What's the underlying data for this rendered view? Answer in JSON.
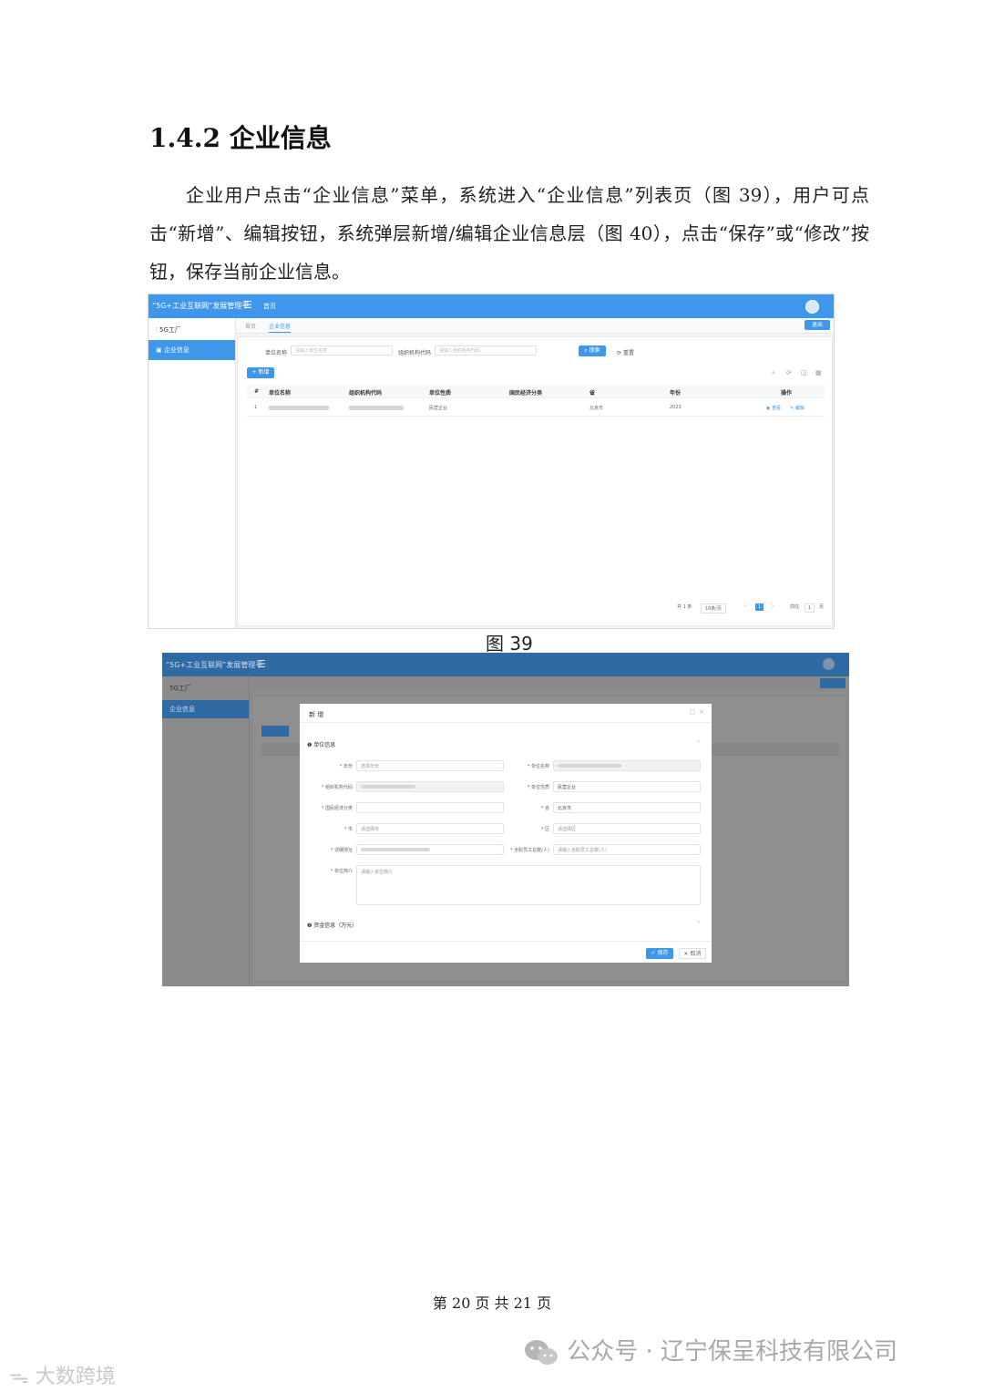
{
  "heading": "1.4.2 企业信息",
  "paragraph": "企业用户点击“企业信息”菜单，系统进入“企业信息”列表页（图 39），用户可点击“新增”、编辑按钮，系统弹层新增/编辑企业信息层（图 40），点击“保存”或“修改”按钮，保存当前企业信息。",
  "figure39": {
    "caption": "图 39",
    "app_title": "“5G+工业互联网”发展管理平",
    "home_tab": "首页",
    "sidebar": [
      "5G工厂",
      "企业信息"
    ],
    "tabs": [
      "首页",
      "企业信息"
    ],
    "top_right_button": "退出",
    "search": {
      "name_label": "单位名称",
      "name_placeholder": "请输入单位名称",
      "code_label": "组织机构代码",
      "code_placeholder": "请输入组织机构代码",
      "search_button": "搜索",
      "reset_button": "重置"
    },
    "add_button": "新增",
    "table": {
      "headers": [
        "#",
        "单位名称",
        "组织机构代码",
        "单位性质",
        "国民经济分类",
        "省",
        "年份",
        "操作"
      ],
      "row": {
        "index": "1",
        "nature": "民营企业",
        "province": "北京市",
        "year": "2023",
        "view": "查看",
        "edit": "编辑"
      }
    },
    "pagination": {
      "total": "共 1 条",
      "page_size": "10条/页",
      "current": "1",
      "goto": "前往",
      "goto_value": "1",
      "page_suffix": "页"
    }
  },
  "figure40": {
    "app_title": "“5G+工业互联网”发展管理平",
    "sidebar": [
      "5G工厂",
      "企业信息"
    ],
    "modal": {
      "title": "新 增",
      "section1": "单位信息",
      "section2": "资金信息（万元）",
      "fields": {
        "year": {
          "label": "* 年份",
          "placeholder": "选择年份"
        },
        "unit_name": {
          "label": "* 单位名称"
        },
        "org_code": {
          "label": "* 组织机构代码"
        },
        "nature": {
          "label": "* 单位性质",
          "value": "民营企业"
        },
        "economy": {
          "label": "* 国民经济分类"
        },
        "province": {
          "label": "* 省",
          "value": "北京市"
        },
        "city": {
          "label": "* 市",
          "placeholder": "请选择市"
        },
        "district": {
          "label": "* 区",
          "placeholder": "请选择区"
        },
        "address": {
          "label": "* 详细地址"
        },
        "staff": {
          "label": "* 全职员工总数(人)",
          "placeholder": "请输入全职员工总数(人)"
        },
        "intro": {
          "label": "* 单位简介",
          "placeholder": "请输入单位简介"
        }
      },
      "save_button": "保存",
      "cancel_button": "取消"
    }
  },
  "caption40": "",
  "footer": "第 20 页 共 21 页",
  "watermark_right": "公众号 · 辽宁保呈科技有限公司",
  "watermark_left": "大数跨境"
}
